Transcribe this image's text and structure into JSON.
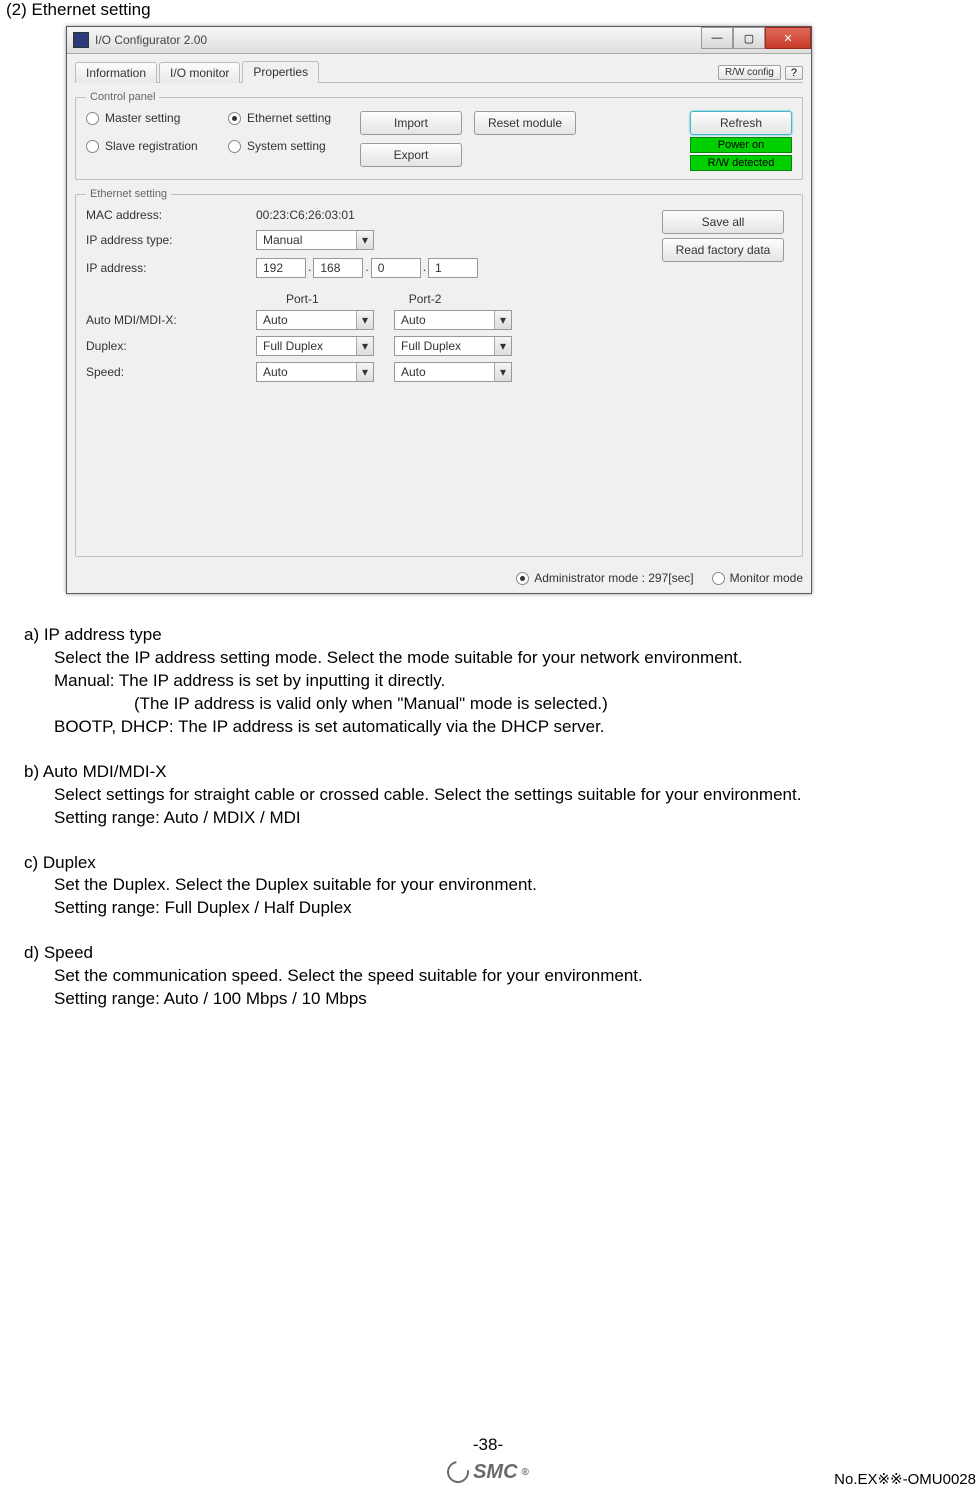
{
  "section_title": "(2) Ethernet setting",
  "window": {
    "title": "I/O Configurator 2.00",
    "tabs": {
      "info": "Information",
      "io": "I/O monitor",
      "props": "Properties"
    },
    "rw_config": "R/W config",
    "help": "?",
    "win_min": "—",
    "win_max": "▢",
    "win_close": "✕"
  },
  "control_panel": {
    "legend": "Control panel",
    "master": "Master setting",
    "slave": "Slave registration",
    "ethernet": "Ethernet setting",
    "system": "System setting",
    "import": "Import",
    "export": "Export",
    "reset": "Reset module",
    "refresh": "Refresh",
    "power_on": "Power on",
    "rw_detected": "R/W detected"
  },
  "ethernet": {
    "legend": "Ethernet setting",
    "mac_label": "MAC address:",
    "mac_value": "00:23:C6:26:03:01",
    "ip_type_label": "IP address type:",
    "ip_type_value": "Manual",
    "ip_label": "IP address:",
    "ip": {
      "a": "192",
      "b": "168",
      "c": "0",
      "d": "1"
    },
    "dot": ".",
    "port1": "Port-1",
    "port2": "Port-2",
    "automdi_label": "Auto MDI/MDI-X:",
    "automdi_p1": "Auto",
    "automdi_p2": "Auto",
    "duplex_label": "Duplex:",
    "duplex_p1": "Full Duplex",
    "duplex_p2": "Full Duplex",
    "speed_label": "Speed:",
    "speed_p1": "Auto",
    "speed_p2": "Auto",
    "save_all": "Save all",
    "read_factory": "Read factory data"
  },
  "mode": {
    "admin": "Administrator mode : 297[sec]",
    "monitor": "Monitor mode"
  },
  "text": {
    "a_head": "a) IP address type",
    "a_l1": "Select the IP address setting mode. Select the mode suitable for your network environment.",
    "a_l2": "Manual: The IP address is set by inputting it directly.",
    "a_l3": "(The IP address is valid only when \"Manual\" mode is selected.)",
    "a_l4": "BOOTP, DHCP: The IP address is set automatically via the DHCP server.",
    "b_head": "b) Auto MDI/MDI-X",
    "b_l1": "Select settings for straight cable or crossed cable. Select the settings suitable for your environment.",
    "b_l2": "Setting range: Auto / MDIX / MDI",
    "c_head": "c) Duplex",
    "c_l1": "Set the Duplex. Select the Duplex suitable for your environment.",
    "c_l2": "Setting range: Full Duplex / Half Duplex",
    "d_head": "d) Speed",
    "d_l1": "Set the communication speed. Select the speed suitable for your environment.",
    "d_l2": "Setting range: Auto / 100 Mbps / 10 Mbps"
  },
  "footer": {
    "page": "-38-",
    "logo": "SMC",
    "reg": "®",
    "docid": "No.EX※※-OMU0028"
  },
  "glyphs": {
    "caret": "▾"
  }
}
